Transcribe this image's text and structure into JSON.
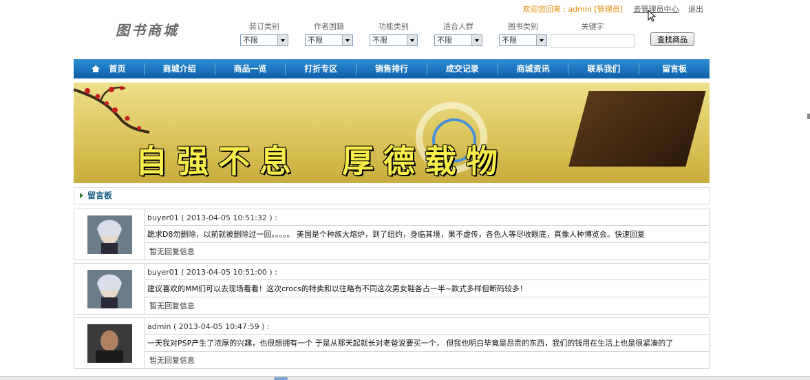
{
  "header": {
    "welcome": "欢迎您回来 : admin [管理员]",
    "admin_link": "去管理员中心",
    "logout": "退出",
    "logo": "图书商城"
  },
  "filters": [
    {
      "label": "装订类别",
      "value": "不限"
    },
    {
      "label": "作者国籍",
      "value": "不限"
    },
    {
      "label": "功能类别",
      "value": "不限"
    },
    {
      "label": "适合人群",
      "value": "不限"
    },
    {
      "label": "图书类别",
      "value": "不限"
    }
  ],
  "search": {
    "label": "关键字",
    "value": "",
    "button": "查找商品"
  },
  "nav": [
    "首页",
    "商城介绍",
    "商品一览",
    "打折专区",
    "销售排行",
    "成交记录",
    "商城资讯",
    "联系我们",
    "留言板"
  ],
  "banner": {
    "slogan": "自强不息　厚德载物"
  },
  "section": {
    "title": "留言板"
  },
  "messages": [
    {
      "user": "buyer01 ( 2013-04-05 10:51:32 ) :",
      "content": "跪求D8勿删除，以前就被删除过一回。。。。。 美国是个种族大熔炉，到了纽约，身临其境，果不虚传，各色人等尽收眼底，真像人种博览会。快速回复",
      "reply": "暂无回复信息",
      "avatar": "anime-avatar"
    },
    {
      "user": "buyer01 ( 2013-04-05 10:51:00 ) :",
      "content": "建议喜欢的MM们可以去现场看看！这次crocs的特卖和以往略有不同这次男女鞋各占一半~款式多样但断码较多！",
      "reply": "暂无回复信息",
      "avatar": "anime-avatar"
    },
    {
      "user": "admin ( 2013-04-05 10:47:59 ) :",
      "content": "一天我对PSP产生了浓厚的兴趣，也很想拥有一个 于是从那天起就长对老爸说要买一个， 但我也明白毕竟是昂贵的东西，我们的钱用在生活上也是很紧凑的了",
      "reply": "暂无回复信息",
      "avatar": "photo-avatar"
    }
  ]
}
